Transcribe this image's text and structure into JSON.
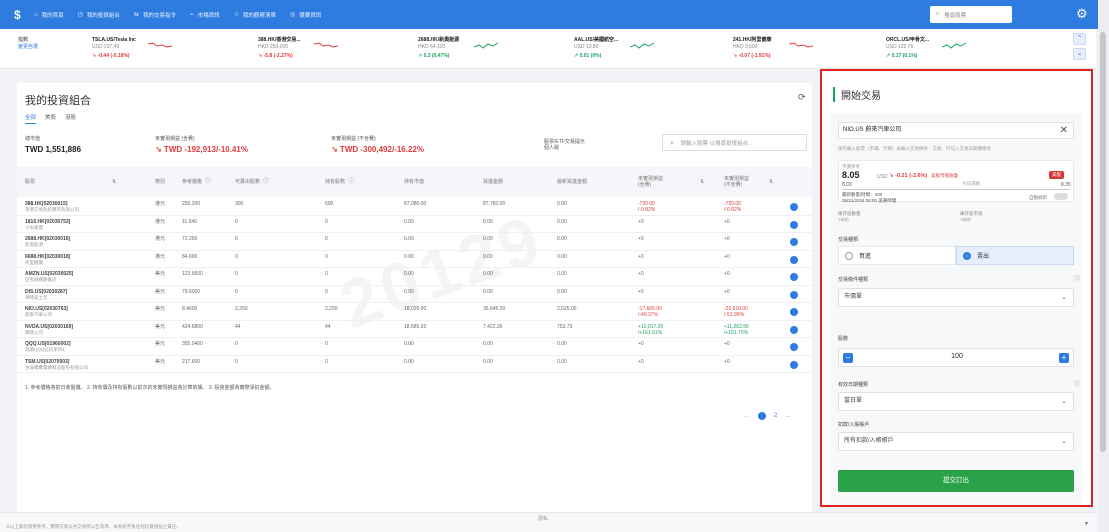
{
  "nav": {
    "items": [
      {
        "icon": "home-icon",
        "label": "我的首頁"
      },
      {
        "icon": "portfolio-icon",
        "label": "我的投資組合"
      },
      {
        "icon": "trade-icon",
        "label": "我的交易指令"
      },
      {
        "icon": "market-icon",
        "label": "市場資訊"
      },
      {
        "icon": "list-icon",
        "label": "我的觀察清單"
      },
      {
        "icon": "contest-icon",
        "label": "競賽資訊"
      }
    ],
    "search_placeholder": "搜尋股票"
  },
  "ticker": {
    "left_label": "指數",
    "left_link": "變更自選",
    "items": [
      {
        "name": "TSLA.US/Tesla Inc",
        "price": "USD 237.49",
        "arrow": "↘",
        "change": "-0.44 (-0.18%)",
        "dir": "down"
      },
      {
        "name": "388.HK/香港交易...",
        "price": "HKD 250.000",
        "arrow": "↘",
        "change": "-5.8 (-2.27%)",
        "dir": "down"
      },
      {
        "name": "2688.HK/新奧能源",
        "price": "HKD 64.100",
        "arrow": "↗",
        "change": "0.3 (0.47%)",
        "dir": "up"
      },
      {
        "name": "AAL.US/美國航空...",
        "price": "USD 13.80",
        "arrow": "↗",
        "change": "0.01 (0%)",
        "dir": "up"
      },
      {
        "name": "241.HK/阿里健康",
        "price": "HKD 3.600",
        "arrow": "↘",
        "change": "-0.07 (-1.91%)",
        "dir": "down"
      },
      {
        "name": "ORCL.US/甲骨文...",
        "price": "USD 132.76",
        "arrow": "↗",
        "change": "0.17 (0.1%)",
        "dir": "up"
      }
    ]
  },
  "portfolio": {
    "title": "我的投資組合",
    "tabs": [
      "全部",
      "美股",
      "港股"
    ],
    "summary": [
      {
        "label": "總市值",
        "value": "TWD 1,551,886",
        "color": "dark"
      },
      {
        "label": "未實現損益 (含費)",
        "value": "↘ TWD -192,913/-10.41%",
        "color": "red"
      },
      {
        "label": "未實現損益 (不含費)",
        "value": "↘ TWD -300,492/-16.22%",
        "color": "red"
      }
    ],
    "fund_label": "股票/ETF交易提示",
    "fund_sub": "個人版",
    "search_placeholder": "請輸入股票 以搜尋投資組合...",
    "headers": [
      "股票",
      "",
      "幣別",
      "參考價格",
      "可賣出股數",
      "持有股數",
      "持有市值",
      "買進金額",
      "最新買進金額",
      "未實現損益(含費)",
      "",
      "未實現損益(不含費)",
      ""
    ],
    "rows": [
      {
        "sym": "388.HK[02030015]",
        "nm": "香港交易及結算所有限公司",
        "cur": "港元",
        "px": "250.200",
        "sell": "300",
        "hold": "600",
        "mv": "87,080.00",
        "buy": "87,760.00",
        "nb": "0.00",
        "u1": "-720.00",
        "u1b": "/-0.82%",
        "u2": "-720.00",
        "u2b": "/-0.82%",
        "col": "red"
      },
      {
        "sym": "1810.HK[02030753]",
        "nm": "小米集團",
        "cur": "港元",
        "px": "11.640",
        "sell": "0",
        "hold": "0",
        "mv": "0.00",
        "buy": "0.00",
        "nb": "0.00",
        "u1": "+0",
        "u1b": "",
        "u2": "+0",
        "u2b": "",
        "col": "plain"
      },
      {
        "sym": "2688.HK[02030016]",
        "nm": "新奧能源",
        "cur": "港元",
        "px": "72.250",
        "sell": "0",
        "hold": "0",
        "mv": "0.00",
        "buy": "0.00",
        "nb": "0.00",
        "u1": "+0",
        "u1b": "",
        "u2": "+0",
        "u2b": "",
        "col": "plain"
      },
      {
        "sym": "6688.HK[02030018]",
        "nm": "阿里健康",
        "cur": "港元",
        "px": "84.600",
        "sell": "0",
        "hold": "0",
        "mv": "0.00",
        "buy": "0.00",
        "nb": "0.00",
        "u1": "+0",
        "u1b": "",
        "u2": "+0",
        "u2b": "",
        "col": "plain"
      },
      {
        "sym": "AMZN.US[02030025]",
        "nm": "亞馬遜網路書店",
        "cur": "美元",
        "px": "123.5600",
        "sell": "0",
        "hold": "0",
        "mv": "0.00",
        "buy": "0.00",
        "nb": "0.00",
        "u1": "+0",
        "u1b": "",
        "u2": "+0",
        "u2b": "",
        "col": "plain"
      },
      {
        "sym": "DIS.US[02030287]",
        "nm": "華特迪士尼",
        "cur": "美元",
        "px": "79.6000",
        "sell": "0",
        "hold": "0",
        "mv": "0.00",
        "buy": "0.00",
        "nb": "0.00",
        "u1": "+0",
        "u1b": "",
        "u2": "+0",
        "u2b": "",
        "col": "plain"
      },
      {
        "sym": "NIO.US[02030763]",
        "nm": "蔚來汽車公司",
        "cur": "美元",
        "px": "8.4600",
        "sell": "2,250",
        "hold": "2,250",
        "mv": "18,035.00",
        "buy": "35,645.00",
        "nb": "2,625.00",
        "u1": "-17,665.00",
        "u1b": "/-49.37%",
        "u2": "-20,610.00",
        "u2b": "/-51.99%",
        "col": "red"
      },
      {
        "sym": "NVDA.US[02030169]",
        "nm": "輝達公司",
        "cur": "美元",
        "px": "424.6800",
        "sell": "44",
        "hold": "44",
        "mv": "18,685.92",
        "buy": "7,422.36",
        "nb": "753.73",
        "u1": "+12,017.29",
        "u1b": "/+161.91%",
        "u2": "+11,263.56",
        "u2b": "/+151.75%",
        "col": "green"
      },
      {
        "sym": "QQQ.US[01960002]",
        "nm": "景順QQQ信託系列1",
        "cur": "美元",
        "px": "355.0400",
        "sell": "0",
        "hold": "0",
        "mv": "0.00",
        "buy": "0.00",
        "nb": "0.00",
        "u1": "+0",
        "u1b": "",
        "u2": "+0",
        "u2b": "",
        "col": "plain"
      },
      {
        "sym": "TSM.US[02070003]",
        "nm": "台灣積體電路製造股份有限公司",
        "cur": "美元",
        "px": "217.600",
        "sell": "0",
        "hold": "0",
        "mv": "0.00",
        "buy": "0.00",
        "nb": "0.00",
        "u1": "+0",
        "u1b": "",
        "u2": "+0",
        "u2b": "",
        "col": "plain"
      }
    ],
    "note": "1. 參考價格為前日收盤價。 2. 持有價及持有股數以前次的未實現損益為計算依據。 3. 投資金額為實際淨扣金額。",
    "pager": {
      "prev": "←",
      "current": "1",
      "next_page": "2",
      "next": "→"
    }
  },
  "trade": {
    "title": "開始交易",
    "symbol": "NIO.US 蔚來汽車公司",
    "hint": "請先輸入股票（市場、代碼）再輸入交易條件：交易、打勾入交易日期價格等",
    "quote_label": "市價參考",
    "price": "8.05",
    "currency": "USD",
    "change": "↘ -0.21 (-2.6%)",
    "market_status": "美股市場收盤",
    "badge": "美股",
    "low": "8.03",
    "mid_label": "今日漲跌",
    "high": "8.35",
    "meta1": "最新數量/時間：200",
    "meta2": "05/31/2024 04:00 美東時間",
    "auto_label": "自動刷新",
    "hold_left_label": "庫存股數量",
    "hold_left_value": "+0(0)",
    "hold_right_label": "庫存股市值",
    "hold_right_value": "+0(0)",
    "side_label": "交易種類",
    "buy": "買進",
    "sell": "賣出",
    "price_type_label": "交易條件種類",
    "price_type": "市價單",
    "qty_label": "股數",
    "qty_minus": "−",
    "qty": "100",
    "qty_plus": "+",
    "validity_label": "有效日期種類",
    "validity": "當日單",
    "fund_label": "扣款/入帳帳戶",
    "fund_value": "所有扣款/入帳帳戶",
    "submit": "提交訂出"
  },
  "footer": {
    "text": "※以上資訊僅供參考，實際交易以各交易所公告為準，本系統不負任何投資損益之責任。",
    "center": "隱私"
  }
}
